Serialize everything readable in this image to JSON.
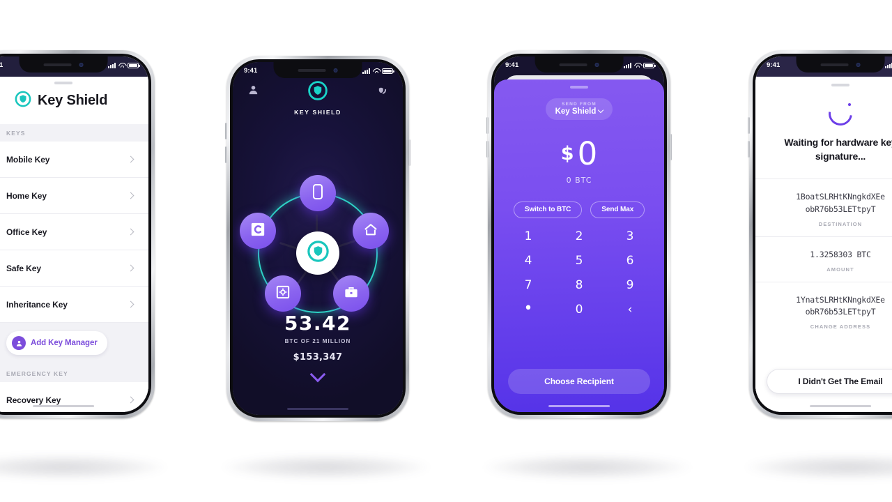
{
  "colors": {
    "purple": "#7b50ec",
    "purple_deep": "#5533e8",
    "teal": "#2ed3c6",
    "dark_navy": "#17123a",
    "page_bg": "#ffffff"
  },
  "status_bar": {
    "time": "9:41",
    "icons": [
      "signal-icon",
      "wifi-icon",
      "battery-icon"
    ]
  },
  "phone1": {
    "app_title": "Key Shield",
    "logo_icon": "key-shield-logo-icon",
    "sections": [
      {
        "header": "KEYS",
        "rows": [
          {
            "label": "Mobile Key",
            "chevron": "chevron-right-icon"
          },
          {
            "label": "Home Key",
            "chevron": "chevron-right-icon"
          },
          {
            "label": "Office Key",
            "chevron": "chevron-right-icon"
          },
          {
            "label": "Safe Key",
            "chevron": "chevron-right-icon"
          },
          {
            "label": "Inheritance Key",
            "chevron": "chevron-right-icon"
          }
        ]
      },
      {
        "header": "EMERGENCY KEY",
        "rows": [
          {
            "label": "Recovery Key",
            "chevron": "chevron-right-icon"
          }
        ]
      }
    ],
    "add_button": {
      "label": "Add Key Manager",
      "icon": "user-avatar-icon"
    }
  },
  "phone2": {
    "brand": "KEY SHIELD",
    "logo_icon": "key-shield-logo-icon",
    "left_icon": "profile-icon",
    "right_icon": "shield-signal-icon",
    "hub_icon": "key-shield-logo-icon",
    "nodes": [
      {
        "name": "mobile-key-node",
        "icon": "phone-icon"
      },
      {
        "name": "home-key-node",
        "icon": "home-icon"
      },
      {
        "name": "office-key-node",
        "icon": "briefcase-icon"
      },
      {
        "name": "safe-key-node",
        "icon": "safe-icon"
      },
      {
        "name": "inheritance-key-node",
        "icon": "c-logo-icon"
      }
    ],
    "balance": {
      "amount": "53.42",
      "caption": "BTC OF 21 MILLION",
      "fiat": "$153,347",
      "expand_icon": "chevron-down-icon"
    }
  },
  "phone3": {
    "send_from_label": "SEND FROM",
    "send_from_value": "Key Shield",
    "send_from_chevron": "chevron-down-icon",
    "currency_symbol": "$",
    "amount": "0",
    "amount_btc": "0 BTC",
    "chips": [
      "Switch to BTC",
      "Send Max"
    ],
    "keypad": [
      [
        "1",
        "2",
        "3"
      ],
      [
        "4",
        "5",
        "6"
      ],
      [
        "7",
        "8",
        "9"
      ],
      [
        "•",
        "0",
        "‹"
      ]
    ],
    "cta": "Choose Recipient"
  },
  "phone4": {
    "spinner_icon": "loading-spinner-icon",
    "title": "Waiting for hardware key signature...",
    "details": [
      {
        "value": "1BoatSLRHtKNngkdXEe obR76b53LETtpyT",
        "key": "DESTINATION"
      },
      {
        "value": "1.3258303 BTC",
        "key": "AMOUNT"
      },
      {
        "value": "1YnatSLRHtKNngkdXEe obR76b53LETtpyT",
        "key": "CHANGE ADDRESS"
      }
    ],
    "cta": "I Didn't Get The Email"
  }
}
